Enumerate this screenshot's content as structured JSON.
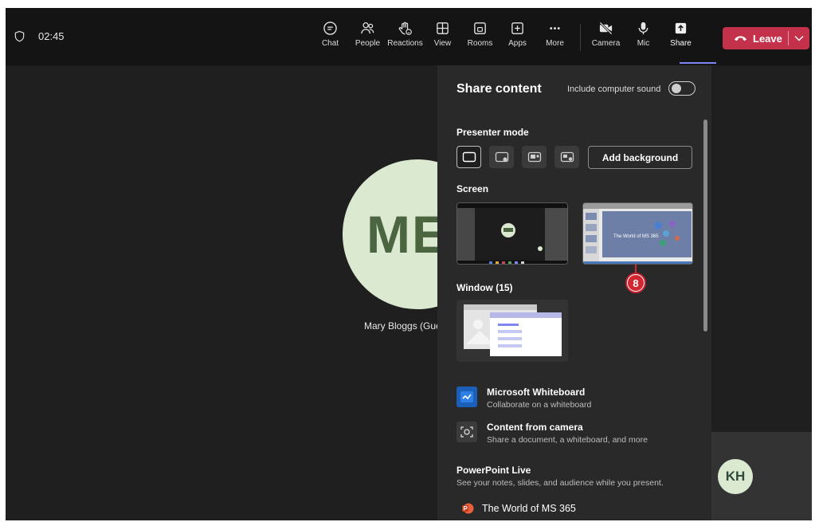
{
  "meeting": {
    "timer": "02:45"
  },
  "toolbar": {
    "items": [
      {
        "id": "chat",
        "label": "Chat"
      },
      {
        "id": "people",
        "label": "People"
      },
      {
        "id": "reactions",
        "label": "Reactions"
      },
      {
        "id": "view",
        "label": "View"
      },
      {
        "id": "rooms",
        "label": "Rooms"
      },
      {
        "id": "apps",
        "label": "Apps"
      },
      {
        "id": "more",
        "label": "More"
      },
      {
        "id": "camera",
        "label": "Camera"
      },
      {
        "id": "mic",
        "label": "Mic"
      },
      {
        "id": "share",
        "label": "Share"
      }
    ],
    "leave_label": "Leave",
    "accent_color": "#c4314b",
    "active_tab_color": "#7f85f5"
  },
  "participants": {
    "main": {
      "initials": "ME",
      "name": "Mary Bloggs (Gues"
    },
    "secondary": {
      "initials": "KH"
    }
  },
  "share_panel": {
    "title": "Share content",
    "include_sound_label": "Include computer sound",
    "include_sound_on": false,
    "presenter_mode_title": "Presenter mode",
    "add_background_label": "Add background",
    "screen_title": "Screen",
    "screen_count": 2,
    "screen2_slide_title": "The World of MS 365",
    "step_badge": "8",
    "window_title": "Window (15)",
    "options": [
      {
        "id": "whiteboard",
        "title": "Microsoft Whiteboard",
        "subtitle": "Collaborate on a whiteboard",
        "icon": "whiteboard-icon"
      },
      {
        "id": "camera",
        "title": "Content from camera",
        "subtitle": "Share a document, a whiteboard, and more",
        "icon": "camera-content-icon"
      }
    ],
    "powerpoint_live": {
      "title": "PowerPoint Live",
      "subtitle": "See your notes, slides, and audience while you present.",
      "file": "The World of MS 365"
    }
  }
}
